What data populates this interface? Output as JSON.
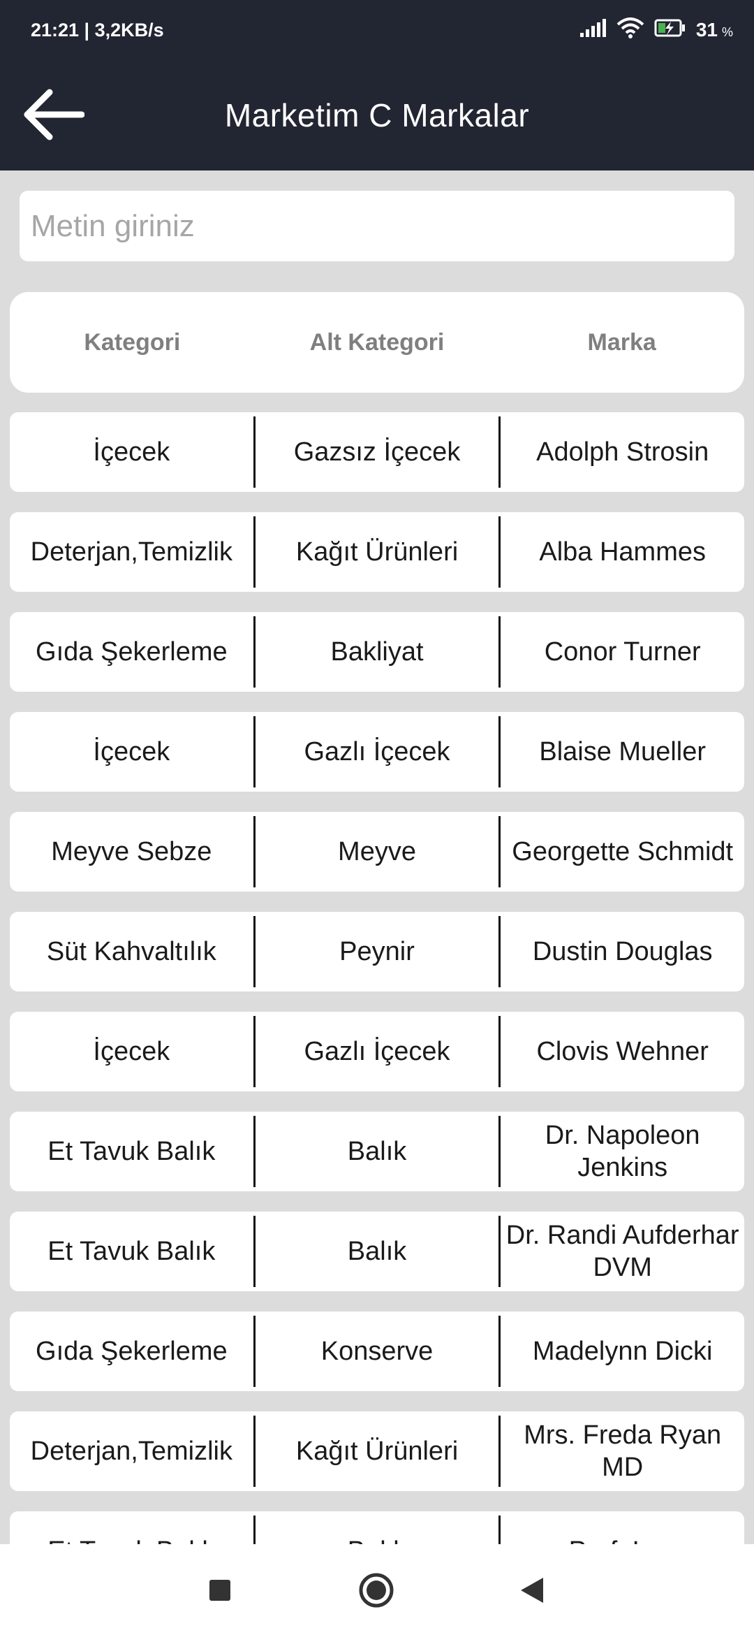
{
  "status_bar": {
    "time_speed": "21:21 | 3,2KB/s",
    "battery_percent": "31",
    "percent_sign": "%"
  },
  "app_bar": {
    "title": "Marketim C Markalar",
    "back_icon": "arrow-left-icon"
  },
  "search": {
    "placeholder": "Metin giriniz",
    "value": ""
  },
  "table": {
    "headers": [
      "Kategori",
      "Alt Kategori",
      "Marka"
    ],
    "rows": [
      [
        "İçecek",
        "Gazsız İçecek",
        "Adolph Strosin"
      ],
      [
        "Deterjan,Temizlik",
        "Kağıt Ürünleri",
        "Alba Hammes"
      ],
      [
        "Gıda Şekerleme",
        "Bakliyat",
        "Conor Turner"
      ],
      [
        "İçecek",
        "Gazlı İçecek",
        "Blaise Mueller"
      ],
      [
        "Meyve Sebze",
        "Meyve",
        "Georgette Schmidt"
      ],
      [
        "Süt Kahvaltılık",
        "Peynir",
        "Dustin Douglas"
      ],
      [
        "İçecek",
        "Gazlı İçecek",
        "Clovis Wehner"
      ],
      [
        "Et Tavuk Balık",
        "Balık",
        "Dr. Napoleon Jenkins"
      ],
      [
        "Et Tavuk Balık",
        "Balık",
        "Dr. Randi Aufderhar DVM"
      ],
      [
        "Gıda Şekerleme",
        "Konserve",
        "Madelynn Dicki"
      ],
      [
        "Deterjan,Temizlik",
        "Kağıt Ürünleri",
        "Mrs. Freda Ryan MD"
      ],
      [
        "Et Tavuk Balık",
        "Balık",
        "Prof. Ima"
      ]
    ]
  },
  "nav_bar": {
    "icons": [
      "recents-square-icon",
      "home-circle-icon",
      "back-triangle-icon"
    ]
  },
  "colors": {
    "app_bar_bg": "#222532",
    "page_bg": "#dcdcdc",
    "card_bg": "#ffffff",
    "header_text": "#7f7f7f"
  }
}
